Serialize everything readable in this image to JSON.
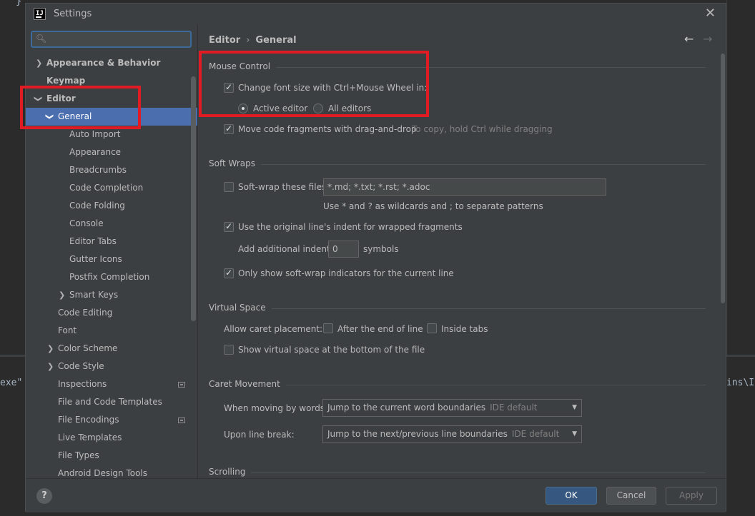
{
  "background": {
    "brace": "}",
    "left_text": "exe\"",
    "right_text": "ins\\I"
  },
  "dialog": {
    "title": "Settings",
    "app_icon": "IJ",
    "close_glyph": "✕"
  },
  "sidebar": {
    "search_placeholder": "",
    "items": [
      {
        "label": "Appearance & Behavior"
      },
      {
        "label": "Keymap"
      },
      {
        "label": "Editor"
      },
      {
        "label": "General"
      },
      {
        "label": "Auto Import"
      },
      {
        "label": "Appearance"
      },
      {
        "label": "Breadcrumbs"
      },
      {
        "label": "Code Completion"
      },
      {
        "label": "Code Folding"
      },
      {
        "label": "Console"
      },
      {
        "label": "Editor Tabs"
      },
      {
        "label": "Gutter Icons"
      },
      {
        "label": "Postfix Completion"
      },
      {
        "label": "Smart Keys"
      },
      {
        "label": "Code Editing"
      },
      {
        "label": "Font"
      },
      {
        "label": "Color Scheme"
      },
      {
        "label": "Code Style"
      },
      {
        "label": "Inspections"
      },
      {
        "label": "File and Code Templates"
      },
      {
        "label": "File Encodings"
      },
      {
        "label": "Live Templates"
      },
      {
        "label": "File Types"
      },
      {
        "label": "Android Design Tools"
      }
    ]
  },
  "breadcrumb": {
    "parent": "Editor",
    "sep": "›",
    "current": "General"
  },
  "nav": {
    "back": "←",
    "forward": "→"
  },
  "mouse_control": {
    "title": "Mouse Control",
    "change_font": "Change font size with Ctrl+Mouse Wheel in:",
    "active_editor": "Active editor",
    "all_editors": "All editors",
    "drag_drop": "Move code fragments with drag-and-drop",
    "drag_hint": "To copy, hold Ctrl while dragging"
  },
  "soft_wraps": {
    "title": "Soft Wraps",
    "soft_wrap_label": "Soft-wrap these files:",
    "soft_wrap_value": "*.md; *.txt; *.rst; *.adoc",
    "wildcard_hint": "Use * and ? as wildcards and ; to separate patterns",
    "use_indent": "Use the original line's indent for wrapped fragments",
    "add_indent_label": "Add additional indent:",
    "add_indent_value": "0",
    "symbols": "symbols",
    "only_show": "Only show soft-wrap indicators for the current line"
  },
  "virtual_space": {
    "title": "Virtual Space",
    "allow_caret": "Allow caret placement:",
    "after_end": "After the end of line",
    "inside_tabs": "Inside tabs",
    "show_virtual": "Show virtual space at the bottom of the file"
  },
  "caret_movement": {
    "title": "Caret Movement",
    "moving_words_label": "When moving by words:",
    "moving_words_value": "Jump to the current word boundaries",
    "moving_words_hint": "IDE default",
    "line_break_label": "Upon line break:",
    "line_break_value": "Jump to the next/previous line boundaries",
    "line_break_hint": "IDE default"
  },
  "scrolling": {
    "title": "Scrolling"
  },
  "footer": {
    "help": "?",
    "ok": "OK",
    "cancel": "Cancel",
    "apply": "Apply"
  },
  "colors": {
    "selection": "#4b6eaf",
    "annotation_red": "#e01b24",
    "primary_button": "#365880"
  }
}
